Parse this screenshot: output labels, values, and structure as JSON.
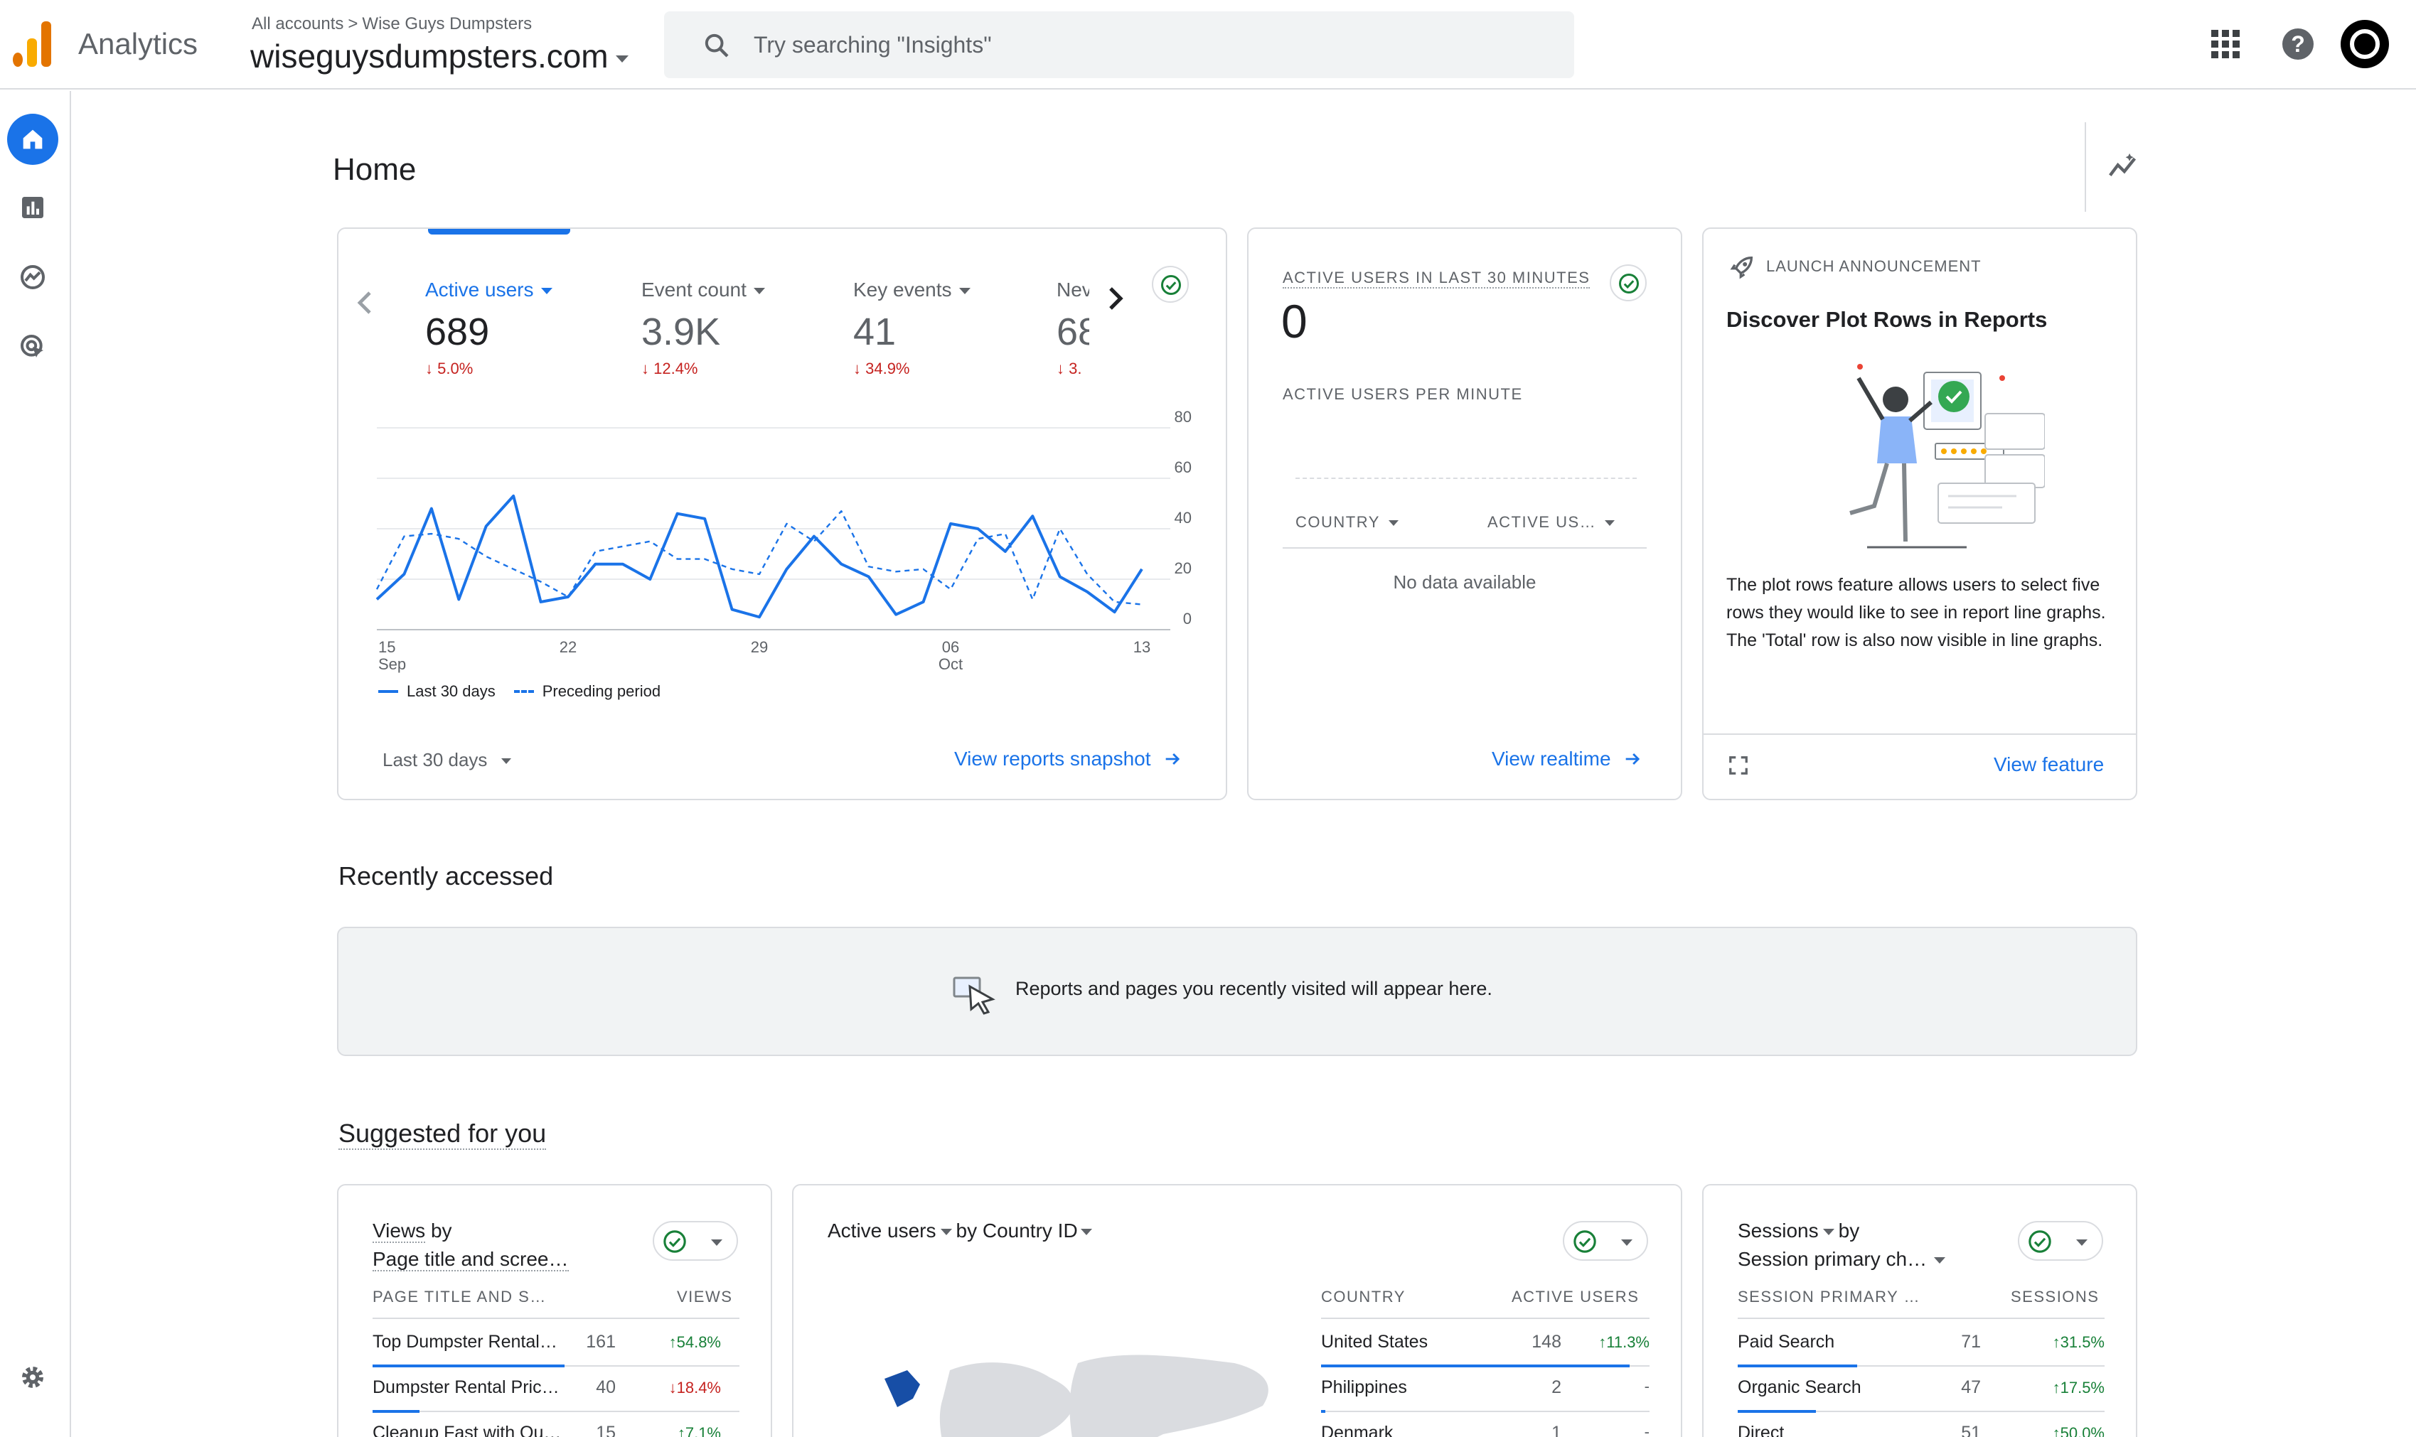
{
  "header": {
    "app_name": "Analytics",
    "breadcrumb_root": "All accounts",
    "breadcrumb_separator": ">",
    "breadcrumb_account": "Wise Guys Dumpsters",
    "property": "wiseguysdumpsters.com",
    "search_placeholder": "Try searching \"Insights\""
  },
  "page": {
    "title": "Home"
  },
  "overview": {
    "metrics": [
      {
        "label": "Active users",
        "value": "689",
        "delta": "↓ 5.0%",
        "active": true
      },
      {
        "label": "Event count",
        "value": "3.9K",
        "delta": "↓ 12.4%"
      },
      {
        "label": "Key events",
        "value": "41",
        "delta": "↓ 34.9%"
      },
      {
        "label": "Nev",
        "value": "68",
        "delta": "↓ 3."
      }
    ],
    "legend_current": "Last 30 days",
    "legend_previous": "Preceding period",
    "period": "Last 30 days",
    "link": "View reports snapshot"
  },
  "chart_data": {
    "type": "line",
    "x_ticks": [
      "15 Sep",
      "22",
      "29",
      "06 Oct",
      "13"
    ],
    "y_ticks": [
      0,
      20,
      40,
      60,
      80
    ],
    "ylim": [
      0,
      80
    ],
    "series": [
      {
        "name": "Last 30 days",
        "style": "solid",
        "color": "#1a73e8",
        "values": [
          12,
          22,
          48,
          12,
          41,
          53,
          11,
          13,
          26,
          26,
          20,
          46,
          44,
          8,
          5,
          24,
          37,
          26,
          21,
          6,
          11,
          42,
          40,
          31,
          45,
          21,
          15,
          7,
          24
        ]
      },
      {
        "name": "Preceding period",
        "style": "dashed",
        "color": "#1a73e8",
        "values": [
          16,
          37,
          38,
          36,
          29,
          24,
          19,
          13,
          31,
          33,
          35,
          28,
          28,
          24,
          22,
          42,
          35,
          47,
          25,
          23,
          24,
          16,
          36,
          38,
          12,
          40,
          22,
          11,
          10
        ]
      }
    ]
  },
  "realtime": {
    "title": "ACTIVE USERS IN LAST 30 MINUTES",
    "value": "0",
    "per_minute": "ACTIVE USERS PER MINUTE",
    "col_country": "COUNTRY",
    "col_active": "ACTIVE US…",
    "empty": "No data available",
    "link": "View realtime"
  },
  "announcement": {
    "kicker": "LAUNCH ANNOUNCEMENT",
    "title": "Discover Plot Rows in Reports",
    "body": "The plot rows feature allows users to select five rows they would like to see in report line graphs. The 'Total' row is also now visible in line graphs.",
    "link": "View feature"
  },
  "recent": {
    "title": "Recently accessed",
    "empty": "Reports and pages you recently visited will appear here."
  },
  "suggested": {
    "title": "Suggested for you",
    "views_card": {
      "metric": "Views",
      "by": "by",
      "dimension": "Page title and scree…",
      "col_dim": "PAGE TITLE AND S…",
      "col_metric": "VIEWS",
      "rows": [
        {
          "label": "Top Dumpster Rental…",
          "value": "161",
          "delta": "↑54.8%",
          "dir": "up"
        },
        {
          "label": "Dumpster Rental Pric…",
          "value": "40",
          "delta": "↓18.4%",
          "dir": "down"
        },
        {
          "label": "Cleanup Fast with Ou…",
          "value": "15",
          "delta": "↑7.1%",
          "dir": "up"
        }
      ]
    },
    "country_card": {
      "metric": "Active users",
      "by": "by",
      "dimension": "Country ID",
      "col_dim": "COUNTRY",
      "col_metric": "ACTIVE USERS",
      "rows": [
        {
          "label": "United States",
          "value": "148",
          "delta": "↑11.3%",
          "dir": "up"
        },
        {
          "label": "Philippines",
          "value": "2",
          "delta": "-",
          "dir": "none"
        },
        {
          "label": "Denmark",
          "value": "1",
          "delta": "-",
          "dir": "none"
        }
      ]
    },
    "sessions_card": {
      "metric": "Sessions",
      "by": "by",
      "dimension": "Session primary ch…",
      "col_dim": "SESSION PRIMARY …",
      "col_metric": "SESSIONS",
      "rows": [
        {
          "label": "Paid Search",
          "value": "71",
          "delta": "↑31.5%",
          "dir": "up"
        },
        {
          "label": "Organic Search",
          "value": "47",
          "delta": "↑17.5%",
          "dir": "up"
        },
        {
          "label": "Direct",
          "value": "51",
          "delta": "↑50.0%",
          "dir": "up"
        }
      ]
    }
  }
}
